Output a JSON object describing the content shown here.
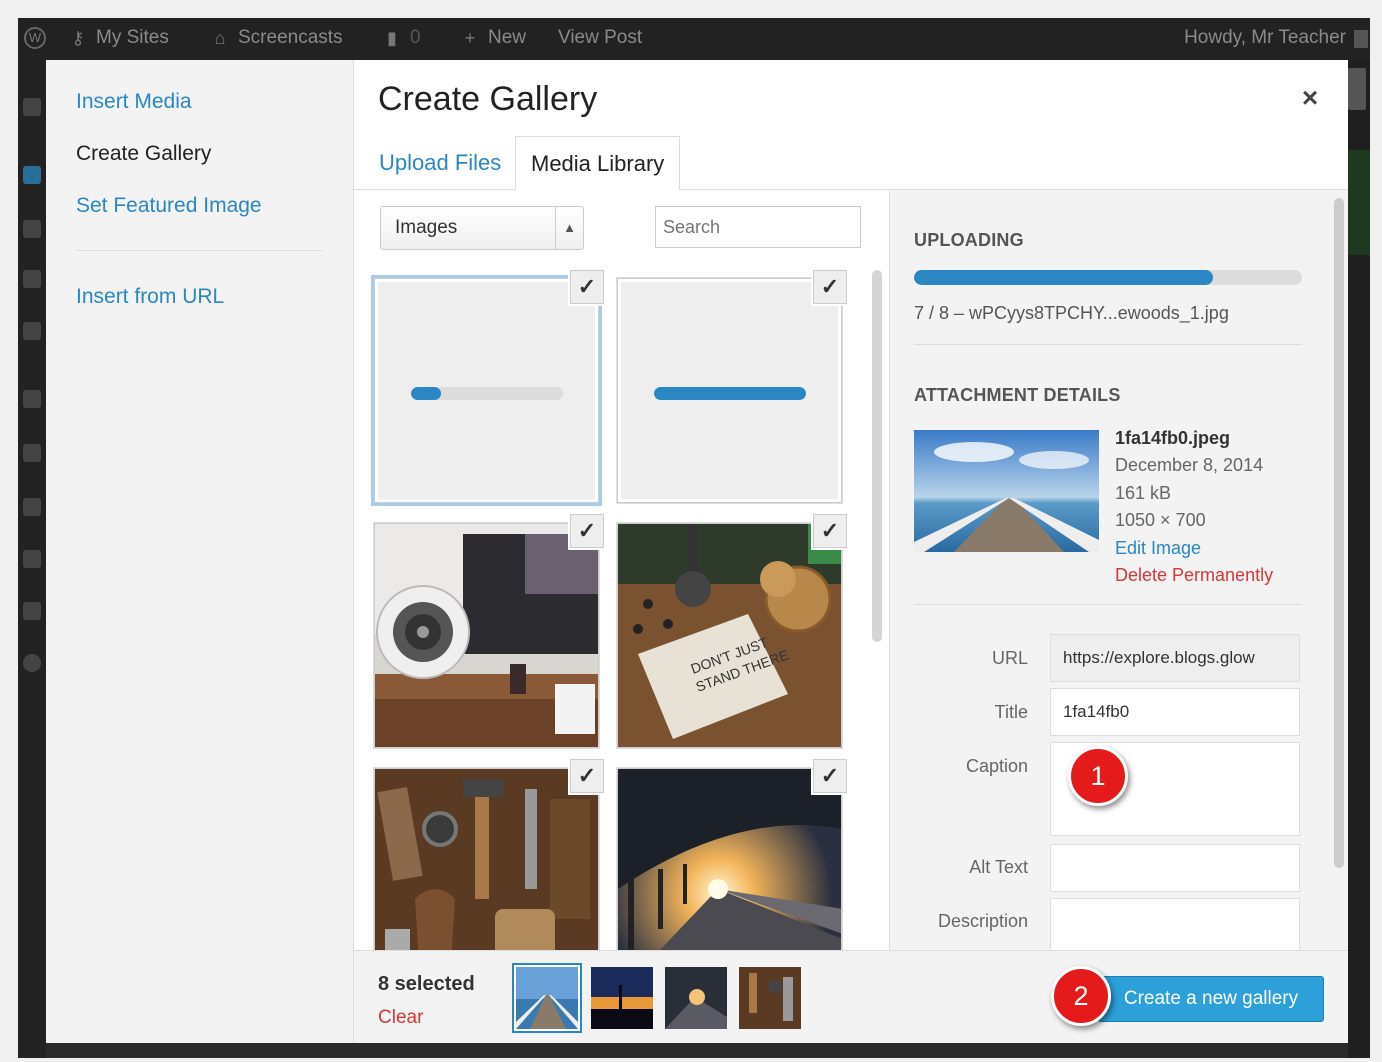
{
  "admin_bar": {
    "my_sites": "My Sites",
    "site_name": "Screencasts",
    "comments_count": "0",
    "new_label": "New",
    "view_post": "View Post",
    "howdy": "Howdy, Mr Teacher"
  },
  "media_menu": {
    "items": [
      "Insert Media",
      "Create Gallery",
      "Set Featured Image"
    ],
    "insert_from_url": "Insert from URL"
  },
  "modal": {
    "title": "Create Gallery",
    "close_glyph": "×",
    "tabs": [
      "Upload Files",
      "Media Library"
    ]
  },
  "filters": {
    "type_selected": "Images",
    "search_placeholder": "Search"
  },
  "grid": {
    "check_glyph": "✓",
    "uploading_tiles": [
      {
        "progress": 0.2
      },
      {
        "progress": 1.0
      }
    ],
    "image_tiles": [
      {
        "name": "desk-speaker-photo"
      },
      {
        "name": "dont-just-stand-there-book-photo"
      },
      {
        "name": "tools-photo"
      },
      {
        "name": "train-platform-photo"
      }
    ]
  },
  "sidebar": {
    "uploading_heading": "UPLOADING",
    "upload_progress": 0.77,
    "upload_file": "7 / 8  –  wPCyys8TPCHY...ewoods_1.jpg",
    "attachment_heading": "ATTACHMENT DETAILS",
    "attachment": {
      "filename": "1fa14fb0.jpeg",
      "date": "December 8, 2014",
      "size": "161 kB",
      "dimensions": "1050 × 700",
      "edit_link": "Edit Image",
      "delete_link": "Delete Permanently"
    },
    "fields": {
      "url_label": "URL",
      "url_value": "https://explore.blogs.glow",
      "title_label": "Title",
      "title_value": "1fa14fb0",
      "caption_label": "Caption",
      "caption_value": "",
      "alt_label": "Alt Text",
      "alt_value": "",
      "description_label": "Description",
      "description_value": ""
    }
  },
  "toolbar": {
    "selected_count": "8 selected",
    "clear": "Clear",
    "create_button": "Create a new gallery"
  },
  "callouts": [
    "1",
    "2"
  ],
  "colors": {
    "accent": "#2a87c4",
    "button": "#2d9fd9",
    "danger": "#d63638",
    "callout": "#e51b1b"
  }
}
